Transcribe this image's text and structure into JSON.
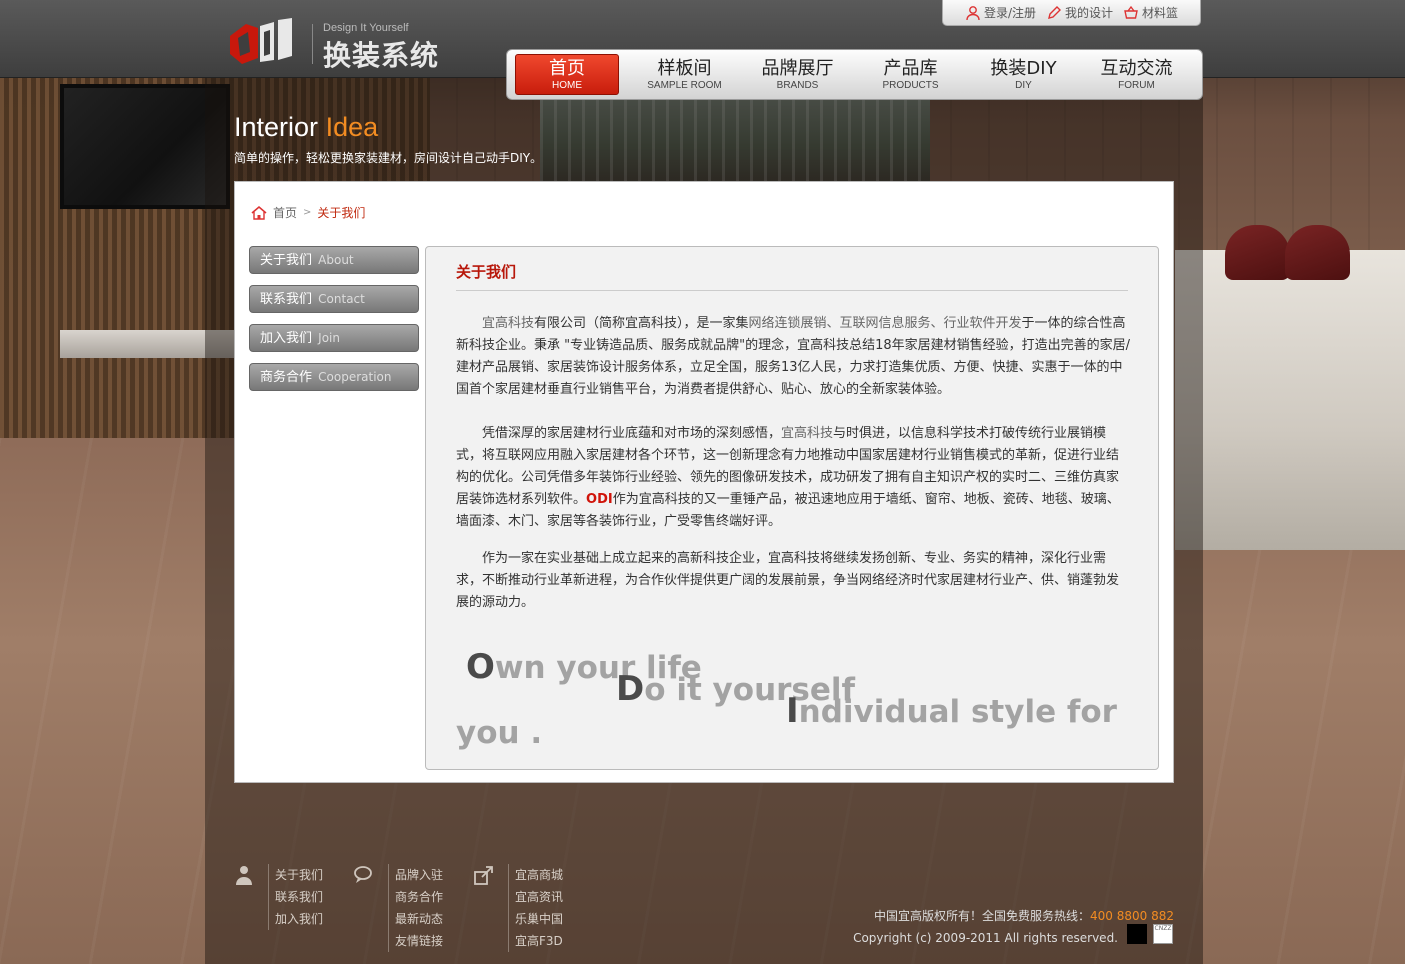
{
  "brand": {
    "tagline": "Design It Yourself",
    "name": "换装系统"
  },
  "userbar": {
    "login": "登录/注册",
    "mydesign": "我的设计",
    "basket": "材料篮"
  },
  "nav": [
    {
      "zh": "首页",
      "en": "HOME"
    },
    {
      "zh": "样板间",
      "en": "SAMPLE ROOM"
    },
    {
      "zh": "品牌展厅",
      "en": "BRANDS"
    },
    {
      "zh": "产品库",
      "en": "PRODUCTS"
    },
    {
      "zh": "换装DIY",
      "en": "DIY"
    },
    {
      "zh": "互动交流",
      "en": "FORUM"
    }
  ],
  "slogan": {
    "word1": "Interior",
    "word2": "Idea",
    "sub": "简单的操作，轻松更换家装建材，房间设计自己动手DIY。"
  },
  "breadcrumb": {
    "home": "首页",
    "sep": ">",
    "current": "关于我们"
  },
  "sidemenu": [
    {
      "zh": "关于我们",
      "en": "About"
    },
    {
      "zh": "联系我们",
      "en": "Contact"
    },
    {
      "zh": "加入我们",
      "en": "Join"
    },
    {
      "zh": "商务合作",
      "en": "Cooperation"
    }
  ],
  "article": {
    "title": "关于我们",
    "p1_a": "宜高科技",
    "p1_b": "有限公司（简称宜高科技），是一家集",
    "p1_c": "网络连锁展销、互联网信息服务、行业软件开发",
    "p1_d": "于一体的综合性高新科技企业。秉承 \"专业铸造品质、服务成就品牌\"的理念，宜高科技总结18年家居建材销售经验，打造出完善的家居/建材产品展销、家居装饰设计服务体系，立足全国，服务13亿人民，力求打造集优质、方便、快捷、实惠于一体的中国首个家居建材垂直行业销售平台，为消费者提供舒心、贴心、放心的全新家装体验。",
    "p2_a": "凭借深厚的家居建材行业底蕴和对市场的深刻感悟，",
    "p2_b": "宜高科技",
    "p2_c": "与时俱进，以信息科学技术打破传统行业展销模式，将互联网应用融入家居建材各个环节，这一创新理念有力地推动中国家居建材行业销售模式的革新，促进行业结构的优化。公司凭借多年装饰行业经验、领先的图像研发技术，成功研发了拥有自主知识产权的实时二、三维仿真家居装饰选材系列软件。",
    "p2_brand": "ODI",
    "p2_d": "作为宜高科技的又一重锤产品，被迅速地应用于墙纸、窗帘、地板、瓷砖、地毯、玻璃、墙面漆、木门、家居等各装饰行业，广受零售终端好评。",
    "p3": "作为一家在实业基础上成立起来的高新科技企业，宜高科技将继续发扬创新、专业、务实的精神，深化行业需求，不断推动行业革新进程，为合作伙伴提供更广阔的发展前景，争当网络经济时代家居建材行业产、供、销蓬勃发展的源动力。",
    "motto1_cap": "O",
    "motto1_rest": "wn your life",
    "motto2_cap": "D",
    "motto2_rest": "o it yourself",
    "motto3_cap": "I",
    "motto3_rest": "ndividual style for",
    "motto4": "you ."
  },
  "footer": {
    "col1": [
      "关于我们",
      "联系我们",
      "加入我们"
    ],
    "col2": [
      "品牌入驻",
      "商务合作",
      "最新动态",
      "友情链接"
    ],
    "col3": [
      "宜高商城",
      "宜高资讯",
      "乐巢中国",
      "宜高F3D"
    ],
    "copy_line1": "中国宜高版权所有！全国免费服务热线：",
    "phone": "400 8800 882",
    "copy_line2": "Copyright (c) 2009-2011 All rights reserved.",
    "cnzz": "CNZZ"
  },
  "colors": {
    "accent_red": "#c81d0c",
    "accent_orange": "#f28c22"
  }
}
